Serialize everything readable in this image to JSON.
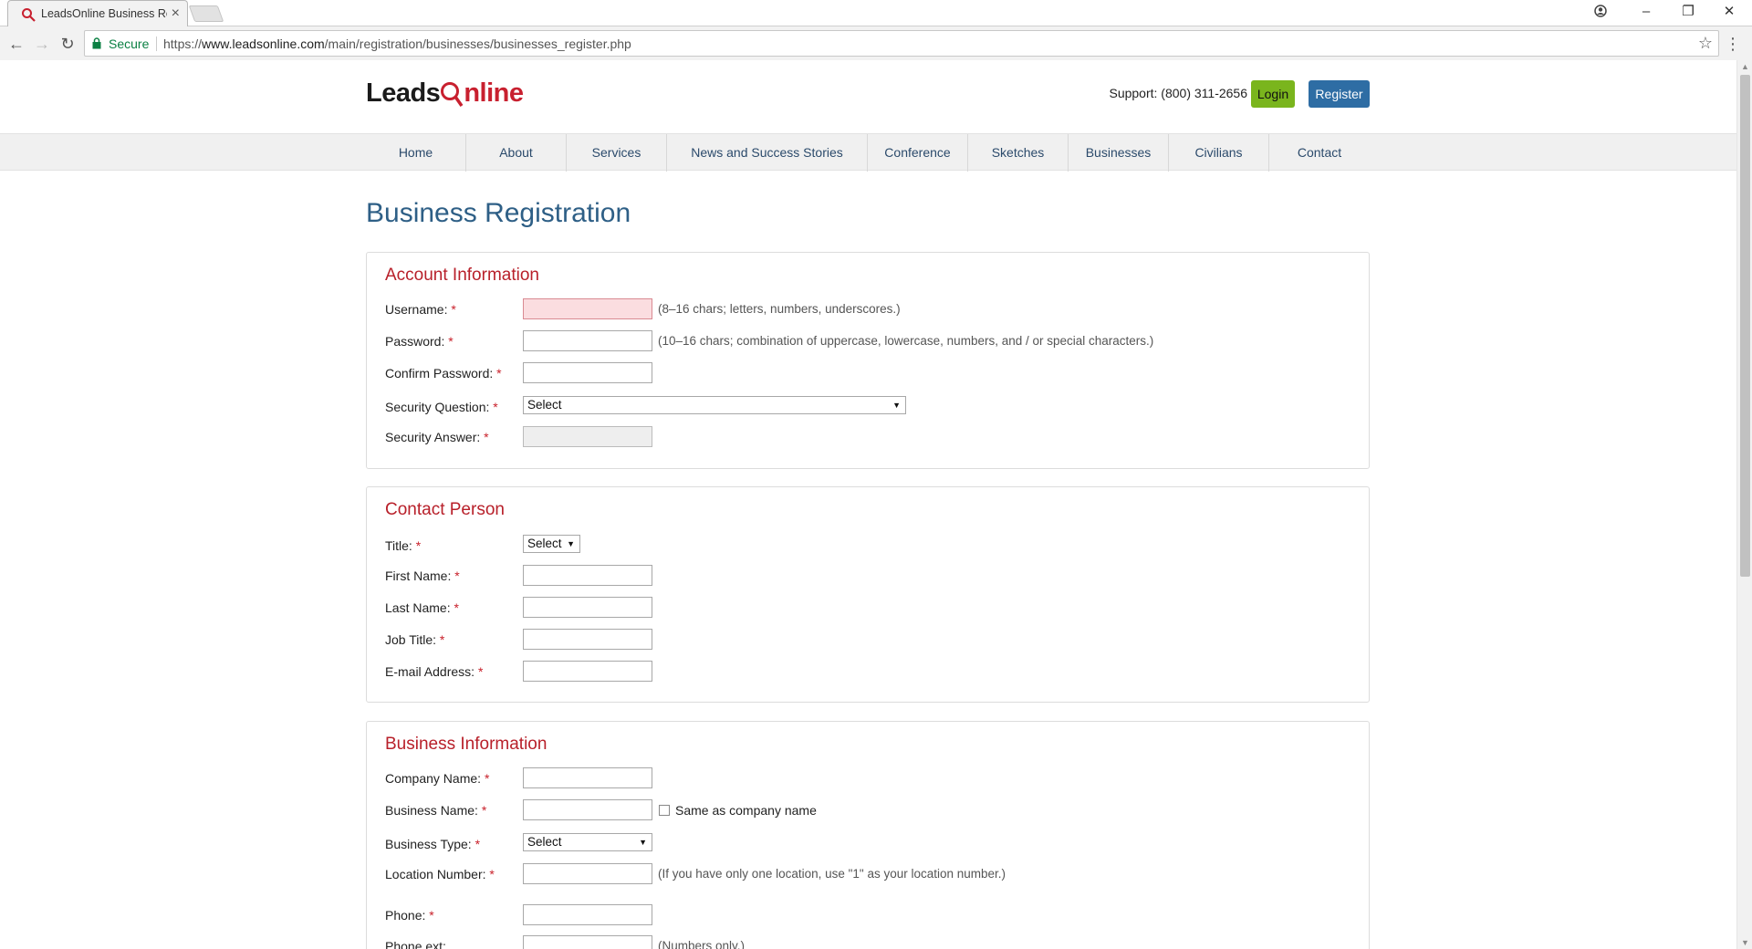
{
  "browser": {
    "tab_title": "LeadsOnline Business Re",
    "secure_label": "Secure",
    "url_scheme": "https://",
    "url_host": "www.leadsonline.com",
    "url_path": "/main/registration/businesses/businesses_register.php"
  },
  "header": {
    "logo_part1": "Leads",
    "logo_part2": "nline",
    "support": "Support: (800) 311-2656",
    "login": "Login",
    "register": "Register"
  },
  "nav": [
    {
      "label": "Home"
    },
    {
      "label": "About"
    },
    {
      "label": "Services"
    },
    {
      "label": "News and Success Stories"
    },
    {
      "label": "Conference"
    },
    {
      "label": "Sketches"
    },
    {
      "label": "Businesses"
    },
    {
      "label": "Civilians"
    },
    {
      "label": "Contact"
    }
  ],
  "page_title": "Business Registration",
  "account": {
    "heading": "Account Information",
    "username_label": "Username:",
    "username_hint": "(8–16 chars; letters, numbers, underscores.)",
    "password_label": "Password:",
    "password_hint": "(10–16 chars; combination of uppercase, lowercase, numbers, and / or special characters.)",
    "confirm_label": "Confirm Password:",
    "question_label": "Security Question:",
    "question_value": "Select",
    "answer_label": "Security Answer:"
  },
  "contact": {
    "heading": "Contact Person",
    "title_label": "Title:",
    "title_value": "Select",
    "first_label": "First Name:",
    "last_label": "Last Name:",
    "job_label": "Job Title:",
    "email_label": "E-mail Address:"
  },
  "business": {
    "heading": "Business Information",
    "company_label": "Company Name:",
    "bname_label": "Business Name:",
    "same_label": "Same as company name",
    "type_label": "Business Type:",
    "type_value": "Select",
    "location_label": "Location Number:",
    "location_hint": "(If you have only one location, use \"1\" as your location number.)",
    "phone_label": "Phone:",
    "ext_label": "Phone ext:",
    "ext_hint": "(Numbers only.)"
  },
  "required_mark": "*",
  "colors": {
    "accent_red": "#b8202a",
    "title_blue": "#2e5f86",
    "login_green": "#7ab51d",
    "register_blue": "#2e6da4"
  }
}
